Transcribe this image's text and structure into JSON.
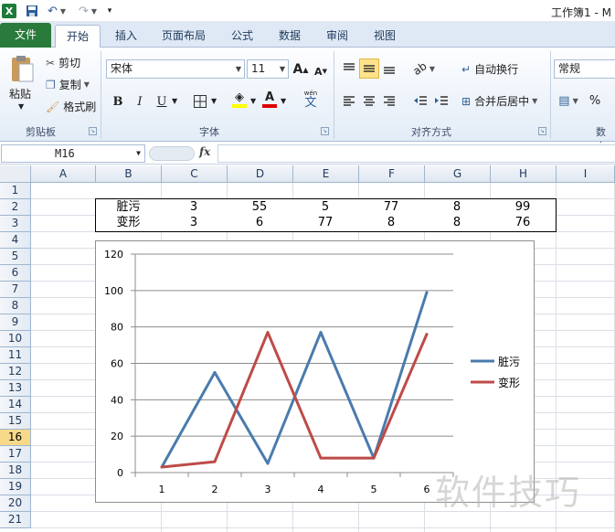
{
  "window": {
    "title": "工作簿1 - M"
  },
  "tabs": [
    "文件",
    "开始",
    "插入",
    "页面布局",
    "公式",
    "数据",
    "审阅",
    "视图"
  ],
  "ribbon": {
    "clipboard": {
      "paste": "粘贴",
      "cut": "剪切",
      "copy": "复制",
      "format_painter": "格式刷",
      "label": "剪贴板"
    },
    "font": {
      "name": "宋体",
      "size": "11",
      "bold": "B",
      "italic": "I",
      "underline": "U",
      "grow": "A",
      "shrink": "A",
      "font_color": "A",
      "phonetic": "wén",
      "phonetic_char": "文",
      "label": "字体"
    },
    "alignment": {
      "wrap_text": "自动换行",
      "merge_center": "合并后居中",
      "label": "对齐方式"
    },
    "number": {
      "format": "常规",
      "percent": "%",
      "label": "数字"
    }
  },
  "formula_bar": {
    "name_box": "M16",
    "fx": "fx",
    "formula": ""
  },
  "sheet": {
    "columns": [
      "A",
      "B",
      "C",
      "D",
      "E",
      "F",
      "G",
      "H",
      "I"
    ],
    "rows": [
      "1",
      "2",
      "3",
      "4",
      "5",
      "6",
      "7",
      "8",
      "9",
      "10",
      "11",
      "12",
      "13",
      "14",
      "15",
      "16",
      "17",
      "18",
      "19",
      "20",
      "21"
    ],
    "selected_row": "16",
    "table": [
      [
        "脏污",
        "3",
        "55",
        "5",
        "77",
        "8",
        "99"
      ],
      [
        "变形",
        "3",
        "6",
        "77",
        "8",
        "8",
        "76"
      ]
    ]
  },
  "chart_data": {
    "type": "line",
    "x": [
      "1",
      "2",
      "3",
      "4",
      "5",
      "6"
    ],
    "series": [
      {
        "name": "脏污",
        "values": [
          3,
          55,
          5,
          77,
          8,
          99
        ],
        "color": "#4a7bad"
      },
      {
        "name": "变形",
        "values": [
          3,
          6,
          77,
          8,
          8,
          76
        ],
        "color": "#be4b48"
      }
    ],
    "ylim": [
      0,
      120
    ],
    "yticks": [
      "0",
      "20",
      "40",
      "60",
      "80",
      "100",
      "120"
    ],
    "grid": true,
    "legend": "right"
  },
  "watermark": "软件技巧"
}
